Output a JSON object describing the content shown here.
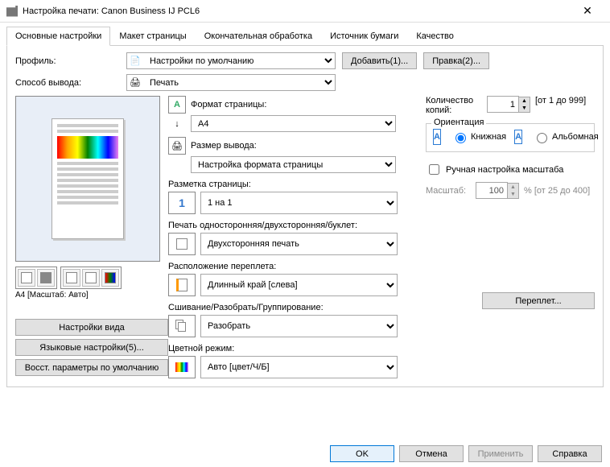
{
  "window": {
    "title": "Настройка печати: Canon Business IJ PCL6"
  },
  "tabs": [
    "Основные настройки",
    "Макет страницы",
    "Окончательная обработка",
    "Источник бумаги",
    "Качество"
  ],
  "profile": {
    "label": "Профиль:",
    "value": "Настройки по умолчанию",
    "add": "Добавить(1)...",
    "edit": "Правка(2)..."
  },
  "output": {
    "label": "Способ вывода:",
    "value": "Печать"
  },
  "preview_caption": "A4 [Масштаб: Авто]",
  "sidebuttons": {
    "view": "Настройки вида",
    "lang": "Языковые настройки(5)...",
    "restore": "Восст. параметры по умолчанию"
  },
  "page_size": {
    "label": "Формат страницы:",
    "value": "A4"
  },
  "out_size": {
    "label": "Размер вывода:",
    "value": "Настройка формата страницы"
  },
  "layout": {
    "label": "Разметка страницы:",
    "value": "1 на 1"
  },
  "duplex": {
    "label": "Печать односторонняя/двухсторонняя/буклет:",
    "value": "Двухсторонняя печать"
  },
  "bind": {
    "label": "Расположение переплета:",
    "value": "Длинный край [слева]",
    "btn": "Переплет..."
  },
  "finish": {
    "label": "Сшивание/Разобрать/Группирование:",
    "value": "Разобрать"
  },
  "color": {
    "label": "Цветной режим:",
    "value": "Авто [цвет/Ч/Б]"
  },
  "copies": {
    "label": "Количество копий:",
    "value": "1",
    "range": "[от 1 до 999]"
  },
  "orient": {
    "legend": "Ориентация",
    "portrait": "Книжная",
    "landscape": "Альбомная"
  },
  "scale": {
    "manual": "Ручная настройка масштаба",
    "label": "Масштаб:",
    "value": "100",
    "range": "% [от 25 до 400]"
  },
  "footer": {
    "ok": "OK",
    "cancel": "Отмена",
    "apply": "Применить",
    "help": "Справка"
  }
}
